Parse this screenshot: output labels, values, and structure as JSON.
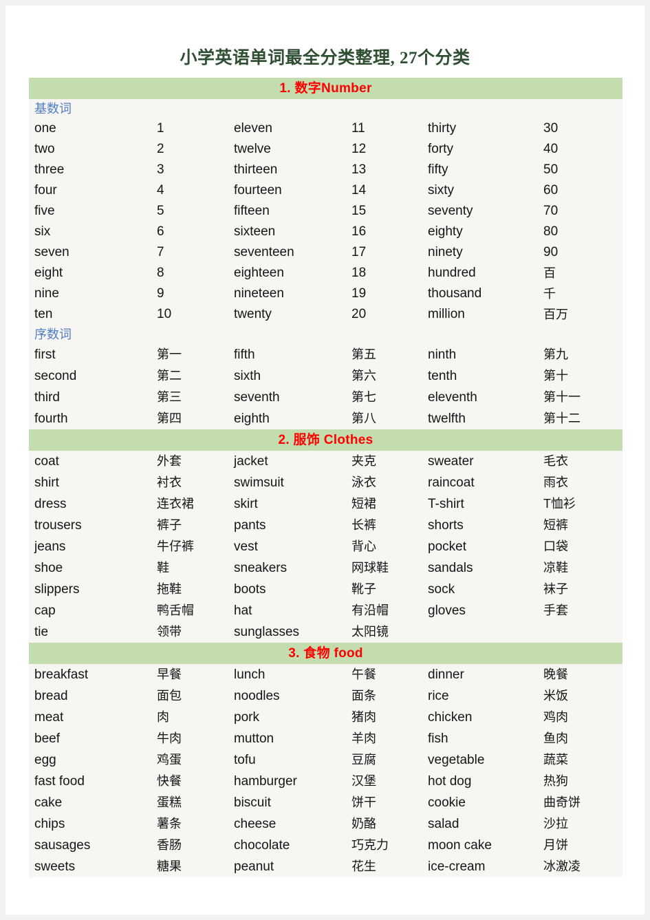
{
  "document": {
    "title": "小学英语单词最全分类整理, 27个分类",
    "title_color": "#2f4f33",
    "header_bg_color": "#c3ddaf",
    "header_text_color": "#ff0000",
    "subheader_text_color": "#4f7cc4",
    "body_bg_color": "#f7f6f3"
  },
  "sections": [
    {
      "header": "1. 数字Number",
      "subsections": [
        {
          "label": "基数词",
          "rows": [
            [
              "one",
              "1",
              "eleven",
              "11",
              "thirty",
              "30"
            ],
            [
              "two",
              "2",
              "twelve",
              "12",
              "forty",
              "40"
            ],
            [
              "three",
              "3",
              "thirteen",
              "13",
              "fifty",
              "50"
            ],
            [
              "four",
              "4",
              "fourteen",
              "14",
              "sixty",
              "60"
            ],
            [
              "five",
              "5",
              "fifteen",
              "15",
              "seventy",
              "70"
            ],
            [
              "six",
              "6",
              "sixteen",
              "16",
              "eighty",
              "80"
            ],
            [
              "seven",
              "7",
              "seventeen",
              "17",
              "ninety",
              "90"
            ],
            [
              "eight",
              "8",
              "eighteen",
              "18",
              "hundred",
              "百"
            ],
            [
              "nine",
              "9",
              "nineteen",
              "19",
              "thousand",
              "千"
            ],
            [
              "ten",
              "10",
              "twenty",
              "20",
              "million",
              "百万"
            ]
          ]
        },
        {
          "label": "序数词",
          "rows": [
            [
              "first",
              "第一",
              "fifth",
              "第五",
              "ninth",
              "第九"
            ],
            [
              "second",
              "第二",
              "sixth",
              "第六",
              "tenth",
              "第十"
            ],
            [
              "third",
              "第三",
              "seventh",
              "第七",
              "eleventh",
              "第十一"
            ],
            [
              "fourth",
              "第四",
              "eighth",
              "第八",
              "twelfth",
              "第十二"
            ]
          ]
        }
      ]
    },
    {
      "header": "2. 服饰  Clothes",
      "subsections": [
        {
          "label": "",
          "rows": [
            [
              "coat",
              "外套",
              "jacket",
              "夹克",
              "sweater",
              "毛衣"
            ],
            [
              "shirt",
              "衬衣",
              "swimsuit",
              "泳衣",
              "raincoat",
              "雨衣"
            ],
            [
              "dress",
              "连衣裙",
              "skirt",
              "短裙",
              "T-shirt",
              "T恤衫"
            ],
            [
              "trousers",
              "裤子",
              "pants",
              "长裤",
              "shorts",
              "短裤"
            ],
            [
              "jeans",
              "牛仔裤",
              "vest",
              "背心",
              "pocket",
              "口袋"
            ],
            [
              "shoe",
              "鞋",
              "sneakers",
              "网球鞋",
              "sandals",
              "凉鞋"
            ],
            [
              "slippers",
              "拖鞋",
              "boots",
              "靴子",
              "sock",
              "袜子"
            ],
            [
              "cap",
              "鸭舌帽",
              "hat",
              "有沿帽",
              "gloves",
              "手套"
            ],
            [
              "tie",
              "领带",
              "sunglasses",
              "太阳镜",
              "",
              ""
            ]
          ]
        }
      ]
    },
    {
      "header": "3. 食物  food",
      "subsections": [
        {
          "label": "",
          "rows": [
            [
              "breakfast",
              "早餐",
              "lunch",
              "午餐",
              "dinner",
              "晚餐"
            ],
            [
              "bread",
              "面包",
              "noodles",
              "面条",
              "rice",
              "米饭"
            ],
            [
              "meat",
              "肉",
              "pork",
              "猪肉",
              "chicken",
              "鸡肉"
            ],
            [
              "beef",
              "牛肉",
              "mutton",
              "羊肉",
              "fish",
              "鱼肉"
            ],
            [
              "egg",
              "鸡蛋",
              "tofu",
              "豆腐",
              "vegetable",
              "蔬菜"
            ],
            [
              "fast food",
              "快餐",
              "hamburger",
              "汉堡",
              "hot dog",
              "热狗"
            ],
            [
              "cake",
              "蛋糕",
              "biscuit",
              "饼干",
              "cookie",
              "曲奇饼"
            ],
            [
              "chips",
              "薯条",
              "cheese",
              "奶酪",
              "salad",
              "沙拉"
            ],
            [
              "sausages",
              "香肠",
              "chocolate",
              "巧克力",
              "moon cake",
              "月饼"
            ],
            [
              "sweets",
              "糖果",
              "peanut",
              "花生",
              "ice-cream",
              "冰激凌"
            ]
          ]
        }
      ]
    }
  ]
}
